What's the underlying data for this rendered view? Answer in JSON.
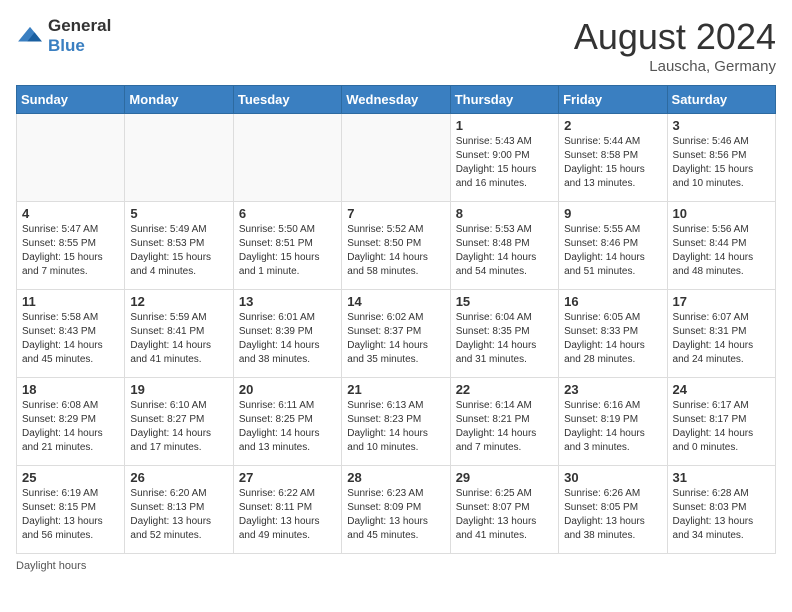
{
  "header": {
    "logo_general": "General",
    "logo_blue": "Blue",
    "month_year": "August 2024",
    "location": "Lauscha, Germany"
  },
  "days_of_week": [
    "Sunday",
    "Monday",
    "Tuesday",
    "Wednesday",
    "Thursday",
    "Friday",
    "Saturday"
  ],
  "weeks": [
    [
      {
        "day": "",
        "info": ""
      },
      {
        "day": "",
        "info": ""
      },
      {
        "day": "",
        "info": ""
      },
      {
        "day": "",
        "info": ""
      },
      {
        "day": "1",
        "info": "Sunrise: 5:43 AM\nSunset: 9:00 PM\nDaylight: 15 hours and 16 minutes."
      },
      {
        "day": "2",
        "info": "Sunrise: 5:44 AM\nSunset: 8:58 PM\nDaylight: 15 hours and 13 minutes."
      },
      {
        "day": "3",
        "info": "Sunrise: 5:46 AM\nSunset: 8:56 PM\nDaylight: 15 hours and 10 minutes."
      }
    ],
    [
      {
        "day": "4",
        "info": "Sunrise: 5:47 AM\nSunset: 8:55 PM\nDaylight: 15 hours and 7 minutes."
      },
      {
        "day": "5",
        "info": "Sunrise: 5:49 AM\nSunset: 8:53 PM\nDaylight: 15 hours and 4 minutes."
      },
      {
        "day": "6",
        "info": "Sunrise: 5:50 AM\nSunset: 8:51 PM\nDaylight: 15 hours and 1 minute."
      },
      {
        "day": "7",
        "info": "Sunrise: 5:52 AM\nSunset: 8:50 PM\nDaylight: 14 hours and 58 minutes."
      },
      {
        "day": "8",
        "info": "Sunrise: 5:53 AM\nSunset: 8:48 PM\nDaylight: 14 hours and 54 minutes."
      },
      {
        "day": "9",
        "info": "Sunrise: 5:55 AM\nSunset: 8:46 PM\nDaylight: 14 hours and 51 minutes."
      },
      {
        "day": "10",
        "info": "Sunrise: 5:56 AM\nSunset: 8:44 PM\nDaylight: 14 hours and 48 minutes."
      }
    ],
    [
      {
        "day": "11",
        "info": "Sunrise: 5:58 AM\nSunset: 8:43 PM\nDaylight: 14 hours and 45 minutes."
      },
      {
        "day": "12",
        "info": "Sunrise: 5:59 AM\nSunset: 8:41 PM\nDaylight: 14 hours and 41 minutes."
      },
      {
        "day": "13",
        "info": "Sunrise: 6:01 AM\nSunset: 8:39 PM\nDaylight: 14 hours and 38 minutes."
      },
      {
        "day": "14",
        "info": "Sunrise: 6:02 AM\nSunset: 8:37 PM\nDaylight: 14 hours and 35 minutes."
      },
      {
        "day": "15",
        "info": "Sunrise: 6:04 AM\nSunset: 8:35 PM\nDaylight: 14 hours and 31 minutes."
      },
      {
        "day": "16",
        "info": "Sunrise: 6:05 AM\nSunset: 8:33 PM\nDaylight: 14 hours and 28 minutes."
      },
      {
        "day": "17",
        "info": "Sunrise: 6:07 AM\nSunset: 8:31 PM\nDaylight: 14 hours and 24 minutes."
      }
    ],
    [
      {
        "day": "18",
        "info": "Sunrise: 6:08 AM\nSunset: 8:29 PM\nDaylight: 14 hours and 21 minutes."
      },
      {
        "day": "19",
        "info": "Sunrise: 6:10 AM\nSunset: 8:27 PM\nDaylight: 14 hours and 17 minutes."
      },
      {
        "day": "20",
        "info": "Sunrise: 6:11 AM\nSunset: 8:25 PM\nDaylight: 14 hours and 13 minutes."
      },
      {
        "day": "21",
        "info": "Sunrise: 6:13 AM\nSunset: 8:23 PM\nDaylight: 14 hours and 10 minutes."
      },
      {
        "day": "22",
        "info": "Sunrise: 6:14 AM\nSunset: 8:21 PM\nDaylight: 14 hours and 7 minutes."
      },
      {
        "day": "23",
        "info": "Sunrise: 6:16 AM\nSunset: 8:19 PM\nDaylight: 14 hours and 3 minutes."
      },
      {
        "day": "24",
        "info": "Sunrise: 6:17 AM\nSunset: 8:17 PM\nDaylight: 14 hours and 0 minutes."
      }
    ],
    [
      {
        "day": "25",
        "info": "Sunrise: 6:19 AM\nSunset: 8:15 PM\nDaylight: 13 hours and 56 minutes."
      },
      {
        "day": "26",
        "info": "Sunrise: 6:20 AM\nSunset: 8:13 PM\nDaylight: 13 hours and 52 minutes."
      },
      {
        "day": "27",
        "info": "Sunrise: 6:22 AM\nSunset: 8:11 PM\nDaylight: 13 hours and 49 minutes."
      },
      {
        "day": "28",
        "info": "Sunrise: 6:23 AM\nSunset: 8:09 PM\nDaylight: 13 hours and 45 minutes."
      },
      {
        "day": "29",
        "info": "Sunrise: 6:25 AM\nSunset: 8:07 PM\nDaylight: 13 hours and 41 minutes."
      },
      {
        "day": "30",
        "info": "Sunrise: 6:26 AM\nSunset: 8:05 PM\nDaylight: 13 hours and 38 minutes."
      },
      {
        "day": "31",
        "info": "Sunrise: 6:28 AM\nSunset: 8:03 PM\nDaylight: 13 hours and 34 minutes."
      }
    ]
  ],
  "footer": {
    "daylight_hours_label": "Daylight hours"
  }
}
